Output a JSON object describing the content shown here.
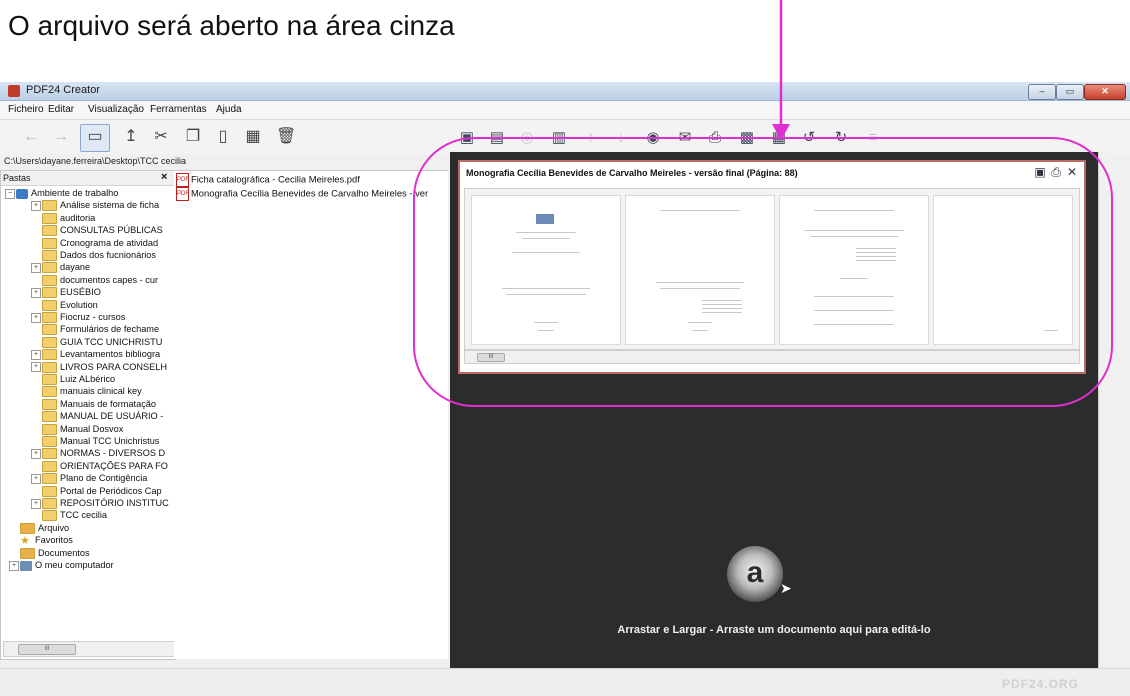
{
  "caption": "O arquivo será aberto na área cinza",
  "window": {
    "title": "PDF24 Creator",
    "controls": {
      "minimize": "–",
      "maximize": "▭",
      "close": "✕"
    }
  },
  "menu": [
    "Ficheiro",
    "Editar",
    "Visualização",
    "Ferramentas",
    "Ajuda"
  ],
  "toolbar_left_icons": [
    "back-arrow-icon",
    "forward-arrow-icon",
    "folder-view-icon",
    "up-icon",
    "cut-icon",
    "copy-icon",
    "paste-icon",
    "grid-icon",
    "trash-icon"
  ],
  "toolbar_right_icons": [
    "save-icon",
    "page-icon",
    "link-icon",
    "trash-icon",
    "up-arrow-icon",
    "down-arrow-icon",
    "eye-icon",
    "mail-icon",
    "print-icon",
    "fax-icon",
    "grid-icon",
    "rotate-left-icon",
    "rotate-right-icon",
    "list-icon"
  ],
  "path": "C:\\Users\\dayane.ferreira\\Desktop\\TCC cecilia",
  "tree": {
    "header": "Pastas",
    "close": "×",
    "items": [
      {
        "label": "Ambiente de trabalho",
        "exp": "−",
        "icon": "desktop"
      },
      {
        "label": "Análise sistema de ficha",
        "exp": "+",
        "icon": "folder"
      },
      {
        "label": "auditoria",
        "exp": "",
        "icon": "folder"
      },
      {
        "label": "CONSULTAS PÚBLICAS",
        "exp": "",
        "icon": "folder"
      },
      {
        "label": "Cronograma de atividad",
        "exp": "",
        "icon": "folder"
      },
      {
        "label": "Dados dos fucnionários",
        "exp": "",
        "icon": "folder"
      },
      {
        "label": "dayane",
        "exp": "+",
        "icon": "folder"
      },
      {
        "label": "documentos capes - cur",
        "exp": "",
        "icon": "folder"
      },
      {
        "label": "EUSÉBIO",
        "exp": "+",
        "icon": "folder"
      },
      {
        "label": "Evolution",
        "exp": "",
        "icon": "folder"
      },
      {
        "label": "Fiocruz - cursos",
        "exp": "+",
        "icon": "folder"
      },
      {
        "label": "Formulários de fechame",
        "exp": "",
        "icon": "folder"
      },
      {
        "label": "GUIA TCC UNICHRISTU",
        "exp": "",
        "icon": "folder"
      },
      {
        "label": "Levantamentos bibliogra",
        "exp": "+",
        "icon": "folder"
      },
      {
        "label": "LIVROS PARA CONSELH",
        "exp": "+",
        "icon": "folder"
      },
      {
        "label": "Luiz ALbérico",
        "exp": "",
        "icon": "folder"
      },
      {
        "label": "manuais clinical key",
        "exp": "",
        "icon": "folder"
      },
      {
        "label": "Manuais de formatação",
        "exp": "",
        "icon": "folder"
      },
      {
        "label": "MANUAL DE USUÁRIO -",
        "exp": "",
        "icon": "folder"
      },
      {
        "label": "Manual Dosvox",
        "exp": "",
        "icon": "folder"
      },
      {
        "label": "Manual TCC Unichristus",
        "exp": "",
        "icon": "folder"
      },
      {
        "label": "NORMAS -  DIVERSOS D",
        "exp": "+",
        "icon": "folder"
      },
      {
        "label": "ORIENTAÇÕES PARA FO",
        "exp": "",
        "icon": "folder"
      },
      {
        "label": "Plano de Contigência",
        "exp": "+",
        "icon": "folder"
      },
      {
        "label": "Portal de Periódicos Cap",
        "exp": "",
        "icon": "folder"
      },
      {
        "label": "REPOSITÓRIO INSTITUC",
        "exp": "+",
        "icon": "folder"
      },
      {
        "label": "TCC cecilia",
        "exp": "",
        "icon": "folder"
      },
      {
        "label": "Arquivo",
        "exp": "",
        "icon": "special"
      },
      {
        "label": "Favoritos",
        "exp": "",
        "icon": "star"
      },
      {
        "label": "Documentos",
        "exp": "",
        "icon": "special"
      },
      {
        "label": "O meu computador",
        "exp": "+",
        "icon": "pc"
      }
    ],
    "scroll_thumb": "III"
  },
  "files": [
    "Ficha catalográfica - Cecilia Meireles.pdf",
    "Monografia Cecília Benevides de Carvalho Meireles - ver"
  ],
  "document": {
    "title": "Monografia Cecília Benevides de Carvalho Meireles - versão final (Página: 88)",
    "icons": [
      "save-icon",
      "print-icon",
      "close-icon"
    ],
    "scroll_thumb": "III"
  },
  "drop_zone": {
    "logo": "a",
    "text": "Arrastar e Largar - Arraste um documento aqui para editá-lo"
  },
  "brand": "PDF24.ORG",
  "annotation_colors": {
    "arrow": "#e02fd0",
    "ellipse": "#e02fd0"
  }
}
